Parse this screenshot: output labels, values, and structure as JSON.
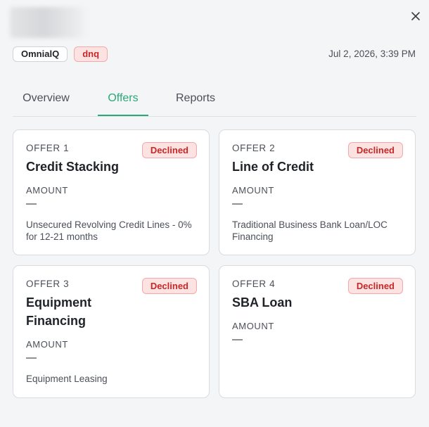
{
  "header": {
    "close_icon": "close-icon",
    "tags": {
      "source": "OmnialQ",
      "status": "dnq"
    },
    "timestamp": "Jul 2, 2026, 3:39 PM"
  },
  "tabs": [
    {
      "label": "Overview",
      "active": false
    },
    {
      "label": "Offers",
      "active": true
    },
    {
      "label": "Reports",
      "active": false
    }
  ],
  "colors": {
    "accent": "#2aa876",
    "declined_text": "#c62828",
    "declined_bg": "#fde2e2"
  },
  "offers": [
    {
      "number": "OFFER 1",
      "status": "Declined",
      "title": "Credit Stacking",
      "amount_label": "AMOUNT",
      "amount": "—",
      "description": "Unsecured Revolving Credit Lines - 0% for 12-21 months"
    },
    {
      "number": "OFFER 2",
      "status": "Declined",
      "title": "Line of Credit",
      "amount_label": "AMOUNT",
      "amount": "—",
      "description": "Traditional Business Bank Loan/LOC Financing"
    },
    {
      "number": "OFFER 3",
      "status": "Declined",
      "title": "Equipment Financing",
      "amount_label": "AMOUNT",
      "amount": "—",
      "description": "Equipment Leasing"
    },
    {
      "number": "OFFER 4",
      "status": "Declined",
      "title": "SBA Loan",
      "amount_label": "AMOUNT",
      "amount": "—",
      "description": ""
    }
  ]
}
